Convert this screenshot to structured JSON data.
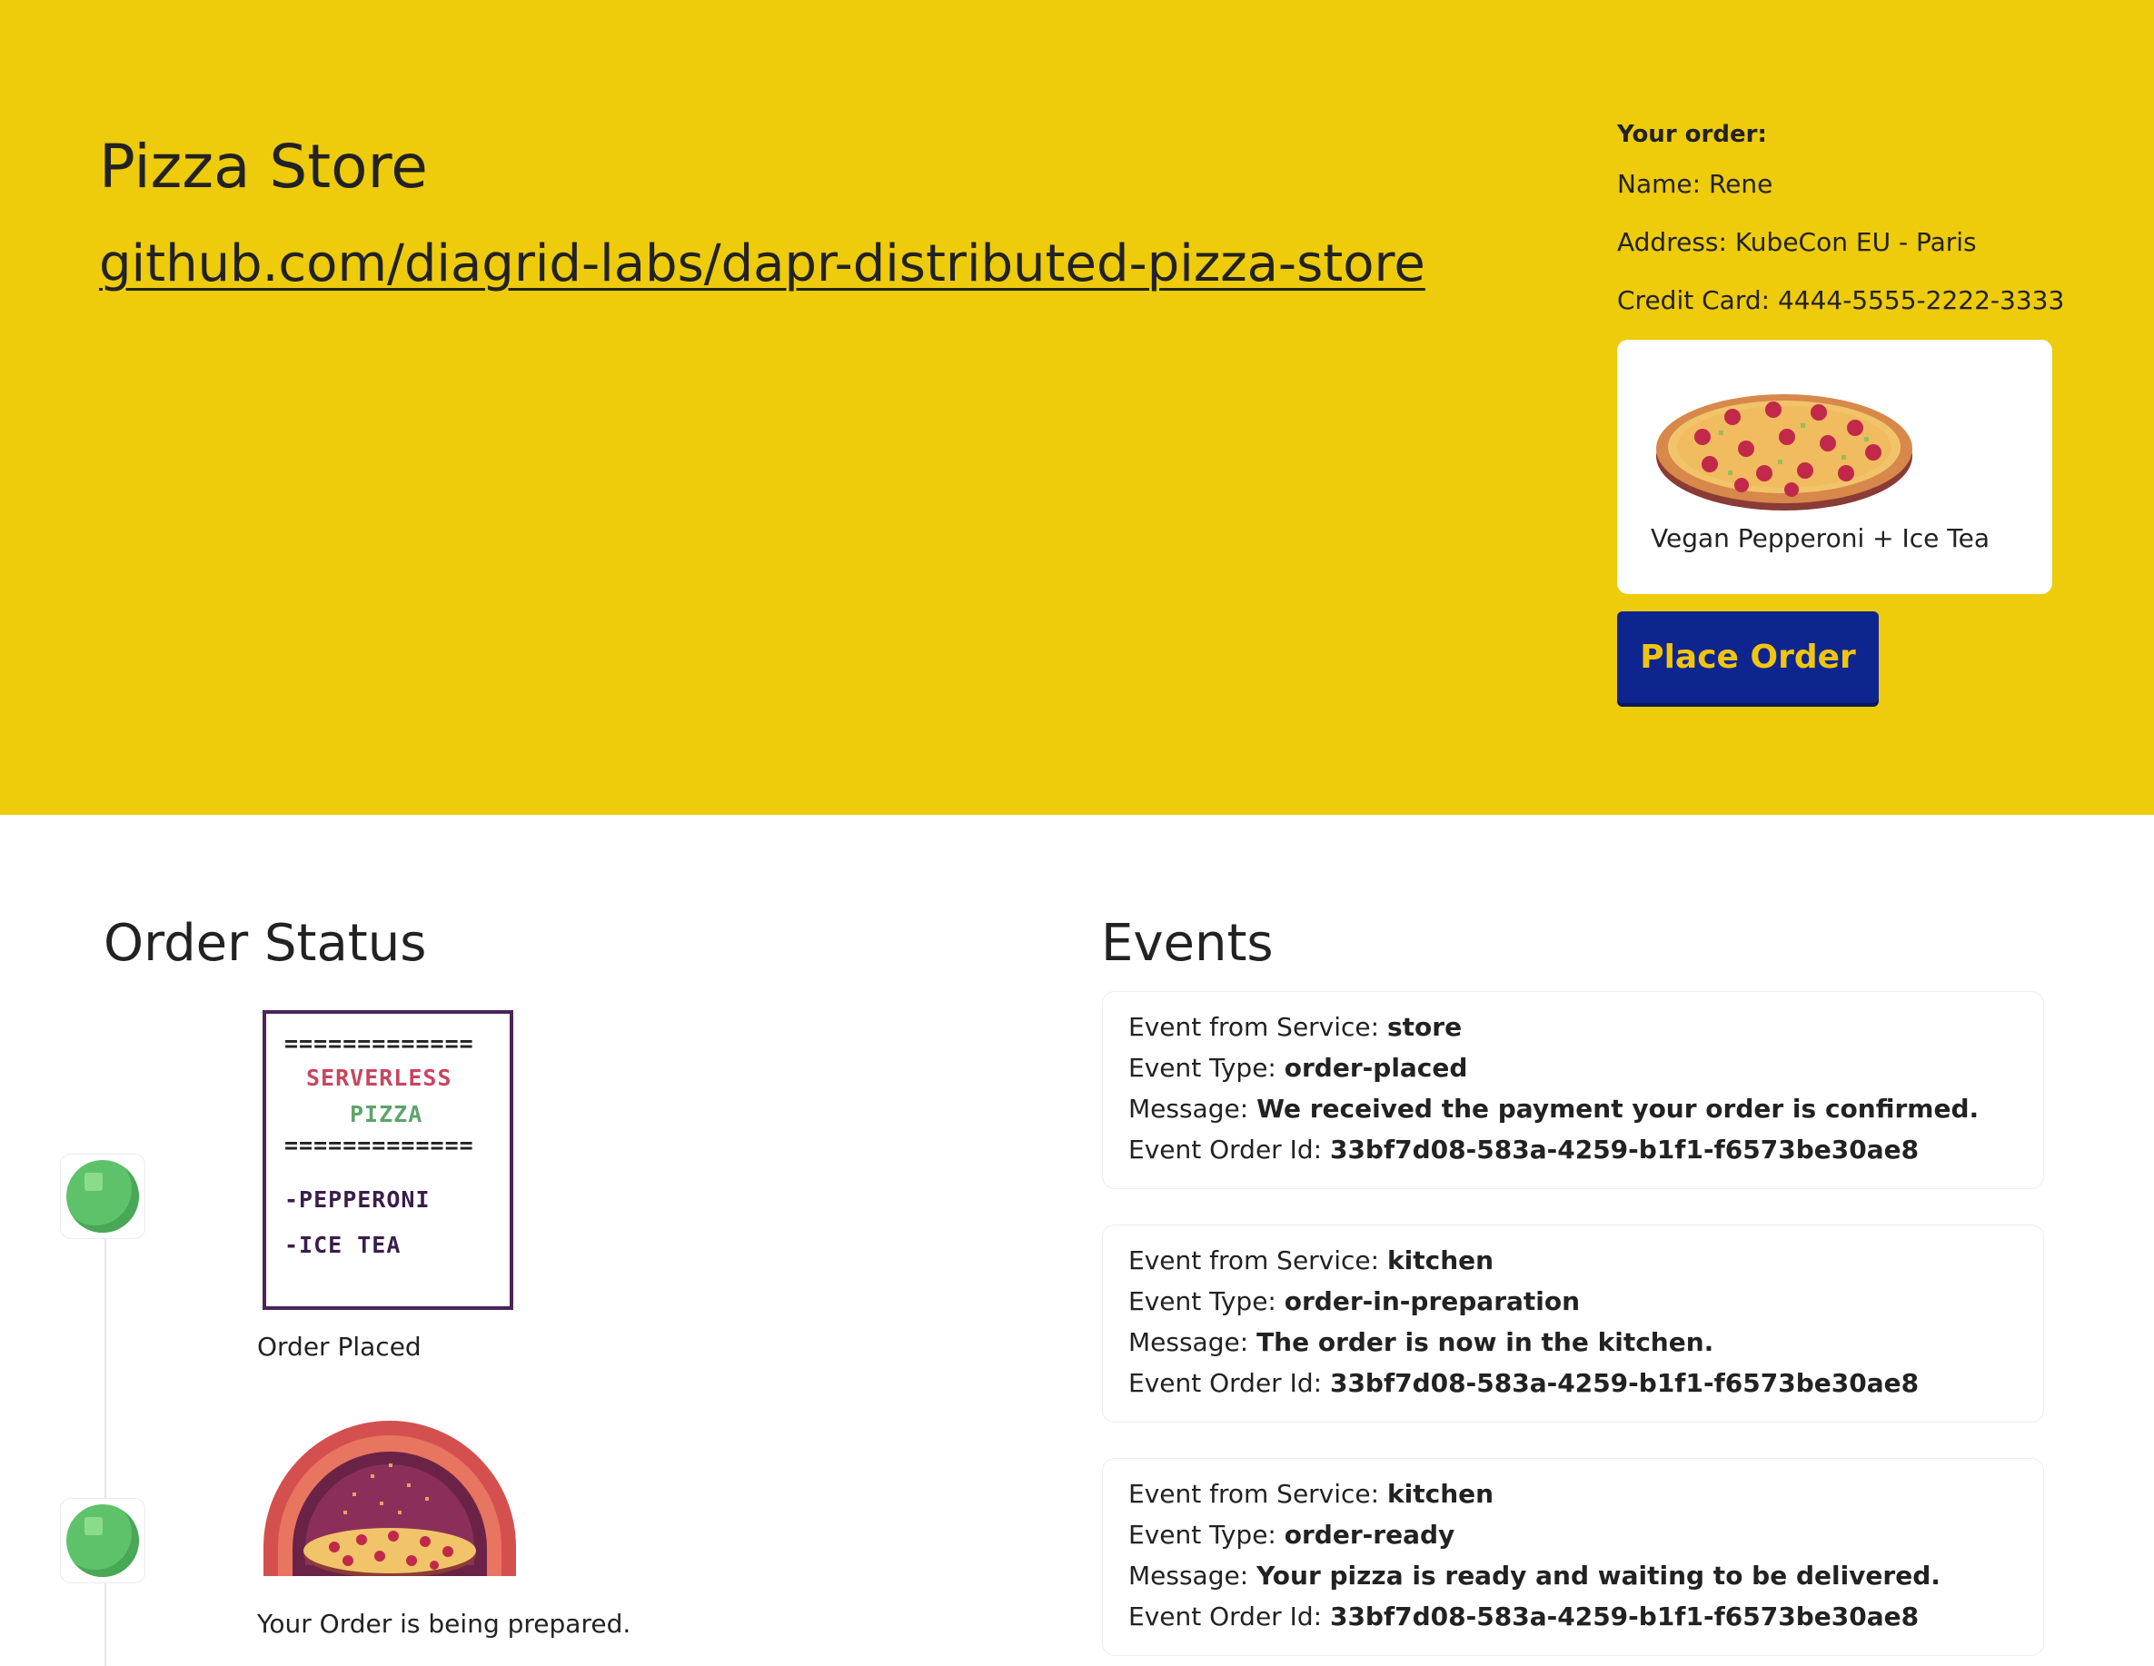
{
  "hero": {
    "title": "Pizza Store",
    "link": "github.com/diagrid-labs/dapr-distributed-pizza-store",
    "background": "#eecb0b"
  },
  "order": {
    "heading": "Your order:",
    "name": "Name: Rene",
    "address": "Address: KubeCon EU - Paris",
    "credit_card": "Credit Card: 4444-5555-2222-3333",
    "item_label": "Vegan Pepperoni + Ice Tea",
    "item_icon": "pizza-icon",
    "place_order_label": "Place Order",
    "button_color": "#0e258f",
    "button_text_color": "#f1c50d"
  },
  "order_status": {
    "title": "Order Status",
    "receipt": {
      "rule": "=============",
      "line1": "SERVERLESS",
      "line2": "PIZZA",
      "item1": "-PEPPERONI",
      "item2": "-ICE TEA"
    },
    "steps": [
      {
        "caption": "Order Placed",
        "icon": "receipt-icon"
      },
      {
        "caption": "Your Order is being prepared.",
        "icon": "oven-icon"
      }
    ],
    "node_color": "#5ec26b"
  },
  "events": {
    "title": "Events",
    "labels": {
      "service": "Event from Service:",
      "type": "Event Type:",
      "message": "Message:",
      "order_id": "Event Order Id:"
    },
    "items": [
      {
        "service": "store",
        "type": "order-placed",
        "message": "We received the payment your order is confirmed.",
        "order_id": "33bf7d08-583a-4259-b1f1-f6573be30ae8"
      },
      {
        "service": "kitchen",
        "type": "order-in-preparation",
        "message": "The order is now in the kitchen.",
        "order_id": "33bf7d08-583a-4259-b1f1-f6573be30ae8"
      },
      {
        "service": "kitchen",
        "type": "order-ready",
        "message": "Your pizza is ready and waiting to be delivered.",
        "order_id": "33bf7d08-583a-4259-b1f1-f6573be30ae8"
      }
    ]
  }
}
